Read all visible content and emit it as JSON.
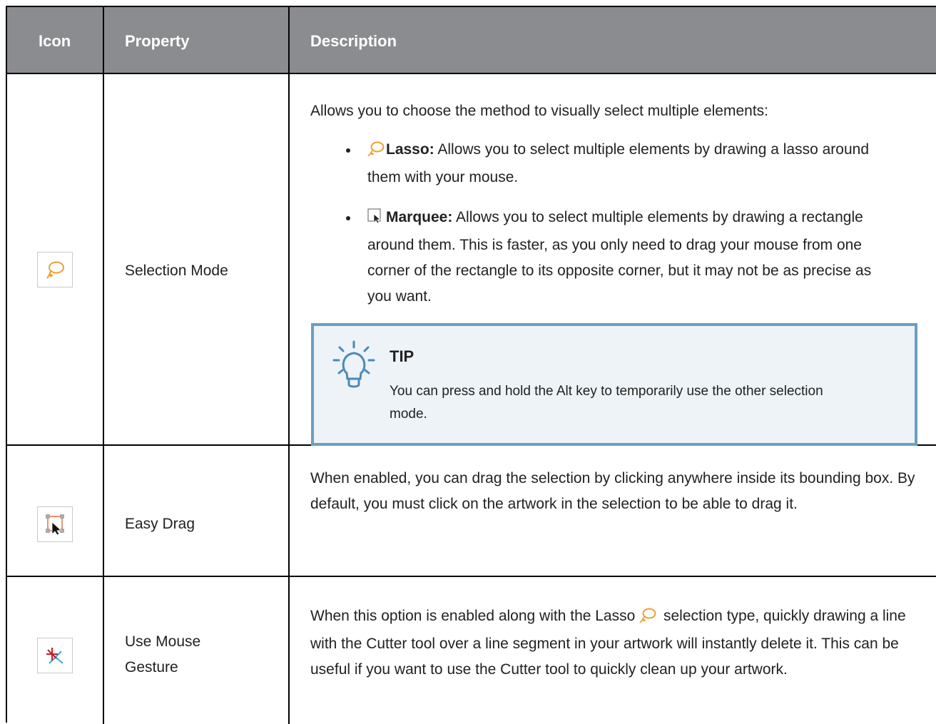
{
  "header": {
    "col_icon": "Icon",
    "col_property": "Property",
    "col_description": "Description"
  },
  "rows": [
    {
      "icon": "lasso-icon",
      "property": "Selection Mode",
      "description_intro": "Allows you to choose the method to visually select multiple elements:",
      "bullets": [
        {
          "icon": "lasso-icon",
          "label": "Lasso:",
          "text": " Allows you to select multiple elements by drawing a lasso around them with your mouse."
        },
        {
          "icon": "marquee-icon",
          "label": "Marquee:",
          "text": " Allows you to select multiple elements by drawing a rectangle around them. This is faster, as you only need to drag your mouse from one corner of the rectangle to its opposite corner, but it may not be as precise as you want."
        }
      ],
      "tip": {
        "title": "TIP",
        "text": "You can press and hold the Alt key to temporarily use the other selection mode."
      }
    },
    {
      "icon": "easy-drag-icon",
      "property": "Easy Drag",
      "description": "When enabled, you can drag the selection by clicking anywhere inside its bounding box. By default, you must click on the artwork in the selection to be able to drag it."
    },
    {
      "icon": "mouse-gesture-icon",
      "property_line1": "Use Mouse",
      "property_line2": "Gesture",
      "description_before": "When this option is enabled along with the Lasso ",
      "description_after": " selection type, quickly drawing a line with the Cutter tool over a line segment in your artwork will instantly delete it. This can be useful if you want to use the Cutter tool to quickly clean up your artwork."
    }
  ],
  "colors": {
    "header_bg": "#8a8c8f",
    "tip_border": "#6c9ec2",
    "tip_bg": "#edf3f7",
    "lasso": "#f0a030"
  }
}
